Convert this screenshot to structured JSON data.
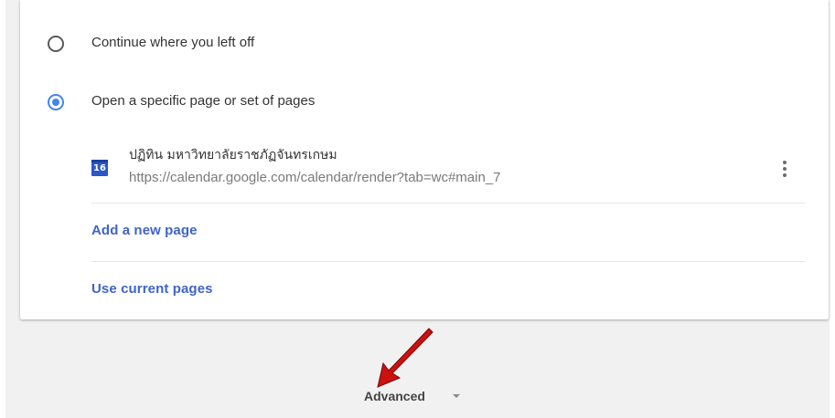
{
  "startup": {
    "options": [
      {
        "label": "Continue where you left off",
        "selected": false
      },
      {
        "label": "Open a specific page or set of pages",
        "selected": true
      }
    ],
    "pages": [
      {
        "icon": "google-calendar-icon",
        "icon_text": "16",
        "title": "ปฏิทิน มหาวิทยาลัยราชภัฏจันทรเกษม",
        "url": "https://calendar.google.com/calendar/render?tab=wc#main_7"
      }
    ],
    "add_page_label": "Add a new page",
    "use_current_label": "Use current pages"
  },
  "advanced": {
    "label": "Advanced"
  },
  "colors": {
    "accent": "#4285f4",
    "link": "#3f64c8",
    "annotation_arrow": "#cc1111"
  }
}
